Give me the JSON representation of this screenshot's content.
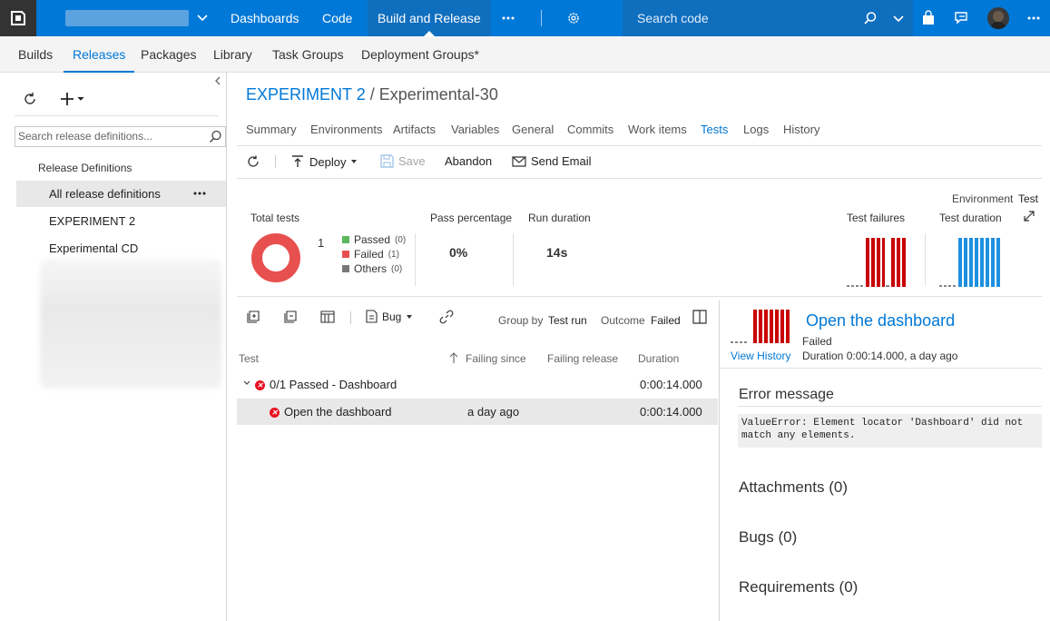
{
  "topbar": {
    "nav": [
      "Dashboards",
      "Code",
      "Build and Release"
    ],
    "search_placeholder": "Search code",
    "colors": {
      "bar": "#0078d7",
      "active": "#106ebe"
    }
  },
  "secnav": {
    "items": [
      "Builds",
      "Releases",
      "Packages",
      "Library",
      "Task Groups",
      "Deployment Groups*"
    ]
  },
  "left": {
    "search_placeholder": "Search release definitions...",
    "section_title": "Release Definitions",
    "items": [
      "All release definitions",
      "EXPERIMENT 2",
      "Experimental CD"
    ]
  },
  "breadcrumb": {
    "project": "EXPERIMENT 2",
    "separator": "/",
    "release": "Experimental-30"
  },
  "tabs": [
    "Summary",
    "Environments",
    "Artifacts",
    "Variables",
    "General",
    "Commits",
    "Work items",
    "Tests",
    "Logs",
    "History"
  ],
  "toolbar": {
    "deploy": "Deploy",
    "save": "Save",
    "abandon": "Abandon",
    "send_email": "Send Email"
  },
  "summary": {
    "environment_label": "Environment",
    "environment_value": "Test",
    "total_tests_label": "Total tests",
    "total_tests": "1",
    "legend": [
      {
        "label": "Passed",
        "count": "(0)",
        "color": "#5cb85c"
      },
      {
        "label": "Failed",
        "count": "(1)",
        "color": "#e85050"
      },
      {
        "label": "Others",
        "count": "(0)",
        "color": "#777777"
      }
    ],
    "pass_pct_label": "Pass percentage",
    "pass_pct": "0%",
    "run_duration_label": "Run duration",
    "run_duration": "14s",
    "test_failures_label": "Test failures",
    "test_duration_label": "Test duration",
    "colors": {
      "failure_bar": "#c80000",
      "duration_bar": "#1e90e0"
    }
  },
  "grid_toolbar": {
    "bug": "Bug",
    "group_by_label": "Group by",
    "group_by_value": "Test run",
    "outcome_label": "Outcome",
    "outcome_value": "Failed"
  },
  "grid": {
    "columns": [
      "Test",
      "Failing since",
      "Failing release",
      "Duration"
    ],
    "group_row": {
      "label": "0/1 Passed - Dashboard",
      "duration": "0:00:14.000"
    },
    "rows": [
      {
        "name": "Open the dashboard",
        "failing_since": "a day ago",
        "duration": "0:00:14.000"
      }
    ]
  },
  "detail": {
    "title": "Open the dashboard",
    "status": "Failed",
    "view_history": "View History",
    "duration_text": "Duration 0:00:14.000, a day ago",
    "error_heading": "Error message",
    "error_text": "ValueError: Element locator 'Dashboard' did not match any elements.",
    "attachments": "Attachments (0)",
    "bugs": "Bugs (0)",
    "requirements": "Requirements (0)"
  }
}
